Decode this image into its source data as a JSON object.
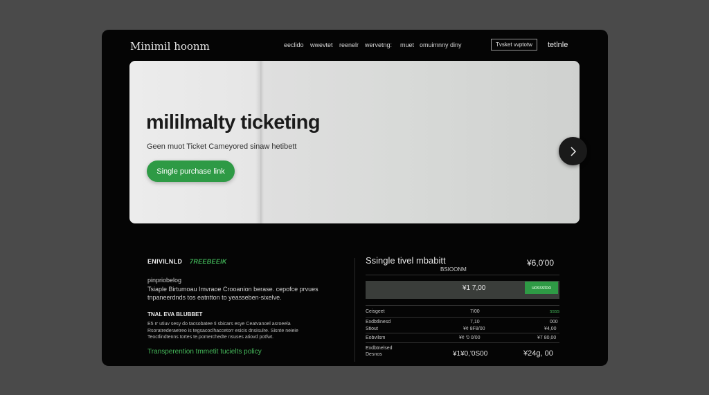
{
  "brand": "Minimil hoonm",
  "nav": {
    "links": [
      "eeclido",
      "wwevtet",
      "reenelr",
      "wervetng:",
      "muet",
      "omuimnny diny"
    ],
    "button_label": "Tvsket vvptotw",
    "right_link": "tetlnle"
  },
  "hero": {
    "title": "mililmalty ticketing",
    "subtitle": "Geen muot Ticket Cameyored sinaw hetibett",
    "cta_label": "Single purchase link",
    "next_icon": "chevron-right-icon"
  },
  "details": {
    "tab_primary": "ENIVILNLD",
    "tab_secondary": "7REEBEEIK",
    "label": "pinpriobelog",
    "paragraph": [
      "Tsiaple Birtumoau  Imvraoe Crooanion berase.  cepofce prvues",
      "tnpaneerdnds  tos eatntton  to  yeasseben-sixelve."
    ],
    "heading": "TNAL EVA BLUBBET",
    "small_paragraph": [
      "E5 rr utiuv sesy do tacsobatee  ti sbicars  esye Ceatvanoel asroeela",
      "Rsoratrederaetreo is tegsacoclhaccetorr  esicis  dnsisulre. Sisnte neieie",
      "Teoctlindtenns  tortes  te.pomerchedte  nsuses atiovd  potfwt."
    ],
    "policy_link": "Transperention tmmetit tucielts policy"
  },
  "summary": {
    "title": "Ssingle tivel mbabitt",
    "price": "¥6,0'00",
    "sublabel": "BSIOONM",
    "selected_price": "¥1 7,00",
    "select_button": "uossstoo",
    "rows": [
      {
        "label": "Ceisgeet",
        "mid": "7/00",
        "right": "ssss",
        "right_green": true
      },
      {
        "label": "Exdbtlinesd",
        "mid": "7,10",
        "right": "000",
        "right_green": false
      },
      {
        "label": "Stiout",
        "mid": "¥¢ 8F8/00",
        "right": "¥4,00",
        "right_green": false
      },
      {
        "label": "Eobvilsm",
        "mid": "¥¢ ′0 0/00",
        "right": "¥7 80,00",
        "right_green": false
      }
    ],
    "total_labels": [
      "Exdbtnelsed",
      "Desnos"
    ],
    "total_mid": "¥1¥0,'0S00",
    "total_right": "¥24g, 00"
  }
}
